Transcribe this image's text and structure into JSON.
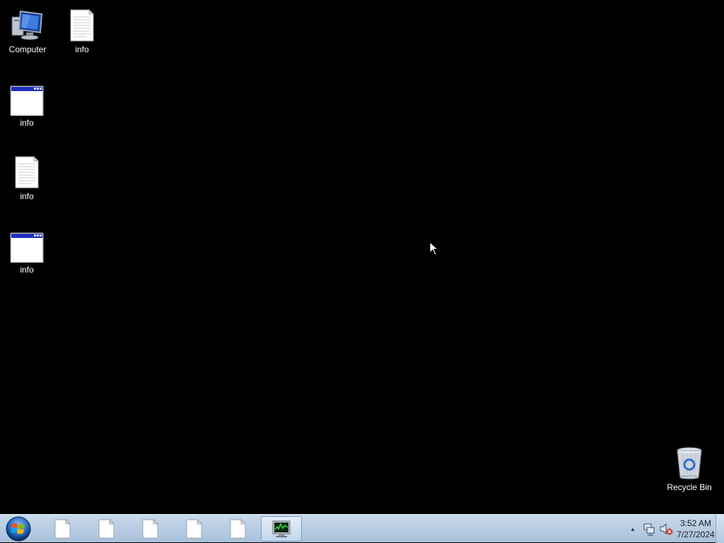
{
  "desktop": {
    "background_color": "#000000",
    "icons": [
      {
        "label": "Computer",
        "icon": "computer-icon"
      },
      {
        "label": "info",
        "icon": "text-file-icon"
      },
      {
        "label": "info",
        "icon": "window-app-icon"
      },
      {
        "label": "info",
        "icon": "text-file-icon"
      },
      {
        "label": "info",
        "icon": "window-app-icon"
      },
      {
        "label": "Recycle Bin",
        "icon": "recycle-bin-icon"
      }
    ]
  },
  "taskbar": {
    "start_button": {
      "icon": "windows-orb-icon"
    },
    "buttons": [
      {
        "icon": "blank-document-icon",
        "active": false
      },
      {
        "icon": "blank-document-icon",
        "active": false
      },
      {
        "icon": "blank-document-icon",
        "active": false
      },
      {
        "icon": "blank-document-icon",
        "active": false
      },
      {
        "icon": "blank-document-icon",
        "active": false
      },
      {
        "icon": "task-manager-icon",
        "active": true
      }
    ],
    "tray": {
      "overflow_icon": "chevron-up-icon",
      "network_icon": "network-icon",
      "volume_icon": "volume-muted-icon",
      "time": "3:52 AM",
      "date": "7/27/2024"
    }
  }
}
